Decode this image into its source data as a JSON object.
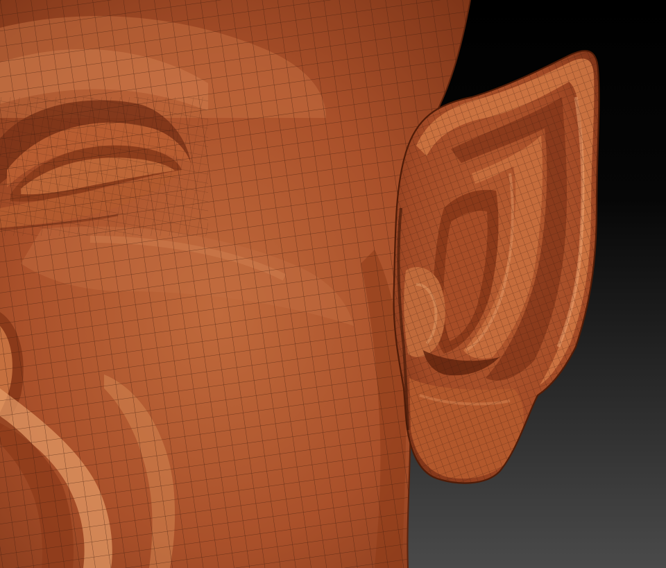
{
  "viewport": {
    "background_top": "#000000",
    "background_bottom": "#4a4a4a"
  },
  "model": {
    "skin_base": "#a9502a",
    "skin_light": "#cc7446",
    "skin_highlight": "#e39562",
    "skin_shadow": "#6f2a12",
    "wire_color": "#3a1a0c"
  },
  "icons": {
    "sculpt-mesh": "polymesh-wireframe-icon"
  }
}
